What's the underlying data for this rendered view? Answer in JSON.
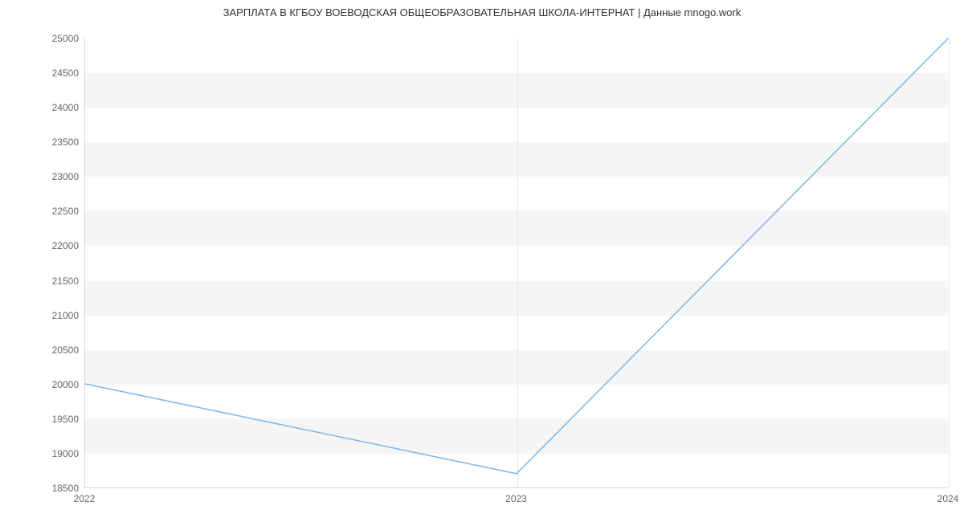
{
  "chart_data": {
    "type": "line",
    "title": "ЗАРПЛАТА В КГБОУ ВОЕВОДСКАЯ ОБЩЕОБРАЗОВАТЕЛЬНАЯ ШКОЛА-ИНТЕРНАТ | Данные mnogo.work",
    "x": [
      2022,
      2023,
      2024
    ],
    "values": [
      20000,
      18700,
      25000
    ],
    "xlabel": "",
    "ylabel": "",
    "xlim": [
      2022,
      2024
    ],
    "ylim": [
      18500,
      25000
    ],
    "x_ticks": [
      2022,
      2023,
      2024
    ],
    "y_ticks": [
      18500,
      19000,
      19500,
      20000,
      20500,
      21000,
      21500,
      22000,
      22500,
      23000,
      23500,
      24000,
      24500,
      25000
    ],
    "line_color": "#7cb5ec"
  }
}
